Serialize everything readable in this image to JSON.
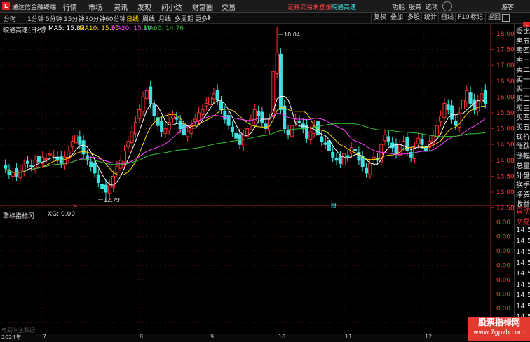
{
  "titlebar": {
    "app_title": "通达信金融终端",
    "menus": [
      "行情",
      "市场",
      "资讯",
      "发现",
      "问小达",
      "财富圈",
      "交易"
    ],
    "warning": "证券交易未登录",
    "stock_name": "皖通高速",
    "right_items": [
      "功能",
      "服务",
      "选项",
      "游客"
    ]
  },
  "toolbar": {
    "periods": [
      "分时",
      "1分钟",
      "5分钟",
      "15分钟",
      "30分钟",
      "60分钟",
      "日线",
      "周线",
      "月线",
      "多周期",
      "更多"
    ],
    "active_period": "日线",
    "tools": [
      "复权",
      "叠加",
      "多股",
      "统计",
      "画线",
      "F10",
      "标记",
      "返回"
    ]
  },
  "legend": {
    "name": "皖通高速(日线)",
    "ma5": "MA5: 15.87",
    "ma10": "MA10: 15.55",
    "ma20": "MA20: 15.19",
    "ma60": "MA60: 14.76",
    "sub_name": "擎标指标冈",
    "sub_value": "XG: 0.00",
    "colors": {
      "ma5": "#ffffff",
      "ma10": "#ffd700",
      "ma20": "#ff40ff",
      "ma60": "#30c030",
      "up": "#ff3030",
      "down": "#40e0e0"
    }
  },
  "annotations": {
    "high": "18.04",
    "low": "12.79",
    "marker_left": "&",
    "marker_right": "财"
  },
  "price_axis": [
    "18.00",
    "17.50",
    "17.00",
    "16.50",
    "16.00",
    "15.50",
    "15.00",
    "14.50",
    "14.00",
    "13.50",
    "13.00",
    "12.50"
  ],
  "sub_axis": [
    "0.00",
    "0.00",
    "0.00",
    "0.00",
    "0.00",
    "0.00",
    "0.00",
    "0.00"
  ],
  "right_panel": [
    "委比",
    "卖五",
    "卖四",
    "卖三",
    "卖二",
    "卖一",
    "买一",
    "买二",
    "买三",
    "买四",
    "买五",
    "现价",
    "涨跌",
    "涨幅",
    "总量",
    "外盘",
    "换手",
    "净资",
    "收益",
    "自动",
    "交易",
    "14:5",
    "14:5",
    "14:5",
    "14:5",
    "14:5",
    "14:5",
    "14:5",
    "14:5",
    "14:5"
  ],
  "bottom": {
    "scroll_label": "电到本主数据",
    "year": "2024年",
    "months": [
      "7",
      "8",
      "9",
      "10",
      "11",
      "12"
    ]
  },
  "watermark": {
    "title": "股票指标网",
    "url": "www.7gpzb.com"
  }
}
